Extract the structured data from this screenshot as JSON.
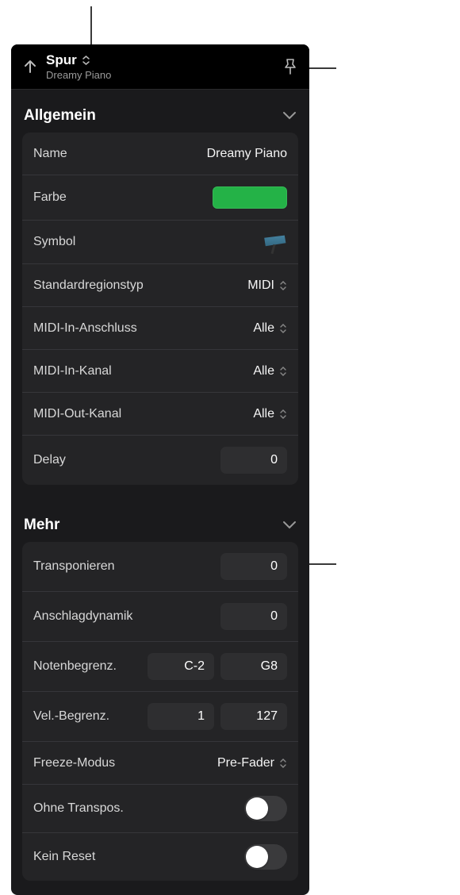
{
  "header": {
    "title": "Spur",
    "subtitle": "Dreamy Piano"
  },
  "sections": {
    "general": {
      "title": "Allgemein",
      "name": {
        "label": "Name",
        "value": "Dreamy Piano"
      },
      "color": {
        "label": "Farbe",
        "value": "#24b247"
      },
      "symbol": {
        "label": "Symbol"
      },
      "regionType": {
        "label": "Standardregionstyp",
        "value": "MIDI"
      },
      "midiInPort": {
        "label": "MIDI-In-Anschluss",
        "value": "Alle"
      },
      "midiInCh": {
        "label": "MIDI-In-Kanal",
        "value": "Alle"
      },
      "midiOutCh": {
        "label": "MIDI-Out-Kanal",
        "value": "Alle"
      },
      "delay": {
        "label": "Delay",
        "value": "0"
      }
    },
    "more": {
      "title": "Mehr",
      "transpose": {
        "label": "Transponieren",
        "value": "0"
      },
      "velocity": {
        "label": "Anschlagdynamik",
        "value": "0"
      },
      "noteLimit": {
        "label": "Notenbegrenz.",
        "low": "C-2",
        "high": "G8"
      },
      "velLimit": {
        "label": "Vel.-Begrenz.",
        "low": "1",
        "high": "127"
      },
      "freeze": {
        "label": "Freeze-Modus",
        "value": "Pre-Fader"
      },
      "noTranspose": {
        "label": "Ohne Transpos.",
        "on": false
      },
      "noReset": {
        "label": "Kein Reset",
        "on": false
      }
    }
  }
}
